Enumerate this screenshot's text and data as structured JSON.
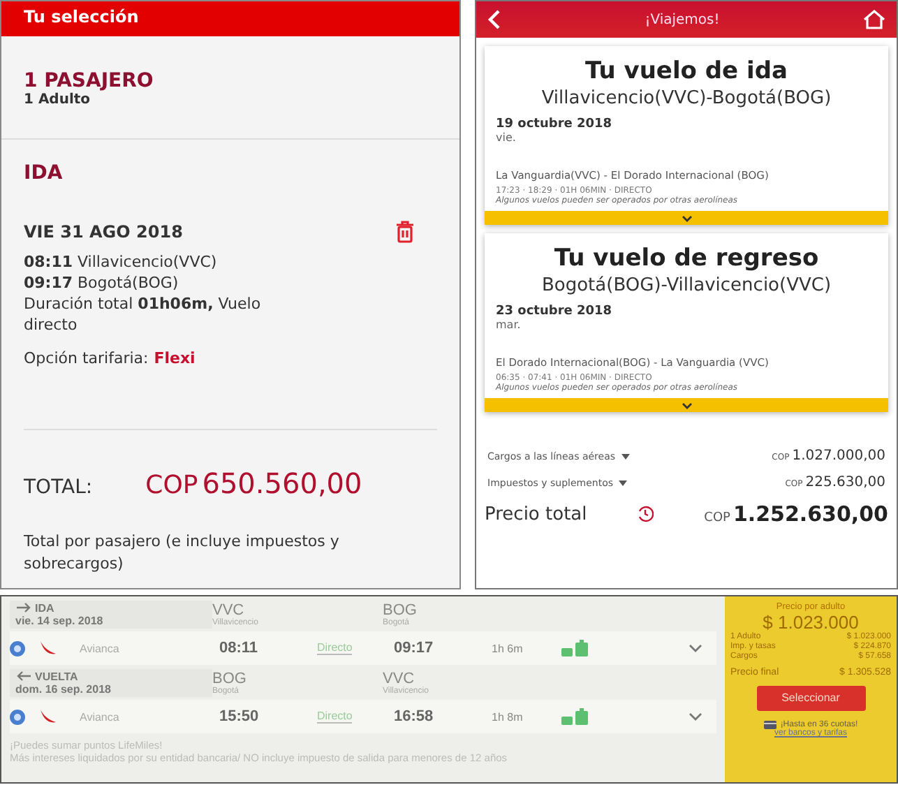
{
  "selection_panel": {
    "header": "Tu selección",
    "passengers_title": "1 PASAJERO",
    "passengers_detail": "1 Adulto",
    "direction": "IDA",
    "date": "VIE 31 AGO 2018",
    "departure": "**08:11** Villavicencio(VVC)",
    "arrival": "**09:17** Bogotá(BOG)",
    "duration": "Duración total **01h06m,** Vuelo directo",
    "fare_label": "Opción tarifaria:",
    "fare_value": "Flexi",
    "total_label": "TOTAL:",
    "total_currency": "COP",
    "total_amount": "650.560,00",
    "note": "Total por pasajero (e incluye impuestos y sobrecargos)"
  },
  "mobile_panel": {
    "title": "¡Viajemos!",
    "flights": [
      {
        "heading": "Tu vuelo de ida",
        "route": "Villavicencio(VVC)-Bogotá(BOG)",
        "date": "19 octubre 2018",
        "weekday": "vie.",
        "airports": "La Vanguardia(VVC) - El Dorado Internacional (BOG)",
        "details": "17:23 · 18:29 · 01H 06MIN · DIRECTO",
        "disclaimer": "Algunos vuelos pueden ser operados por otras aerolíneas"
      },
      {
        "heading": "Tu vuelo de regreso",
        "route": "Bogotá(BOG)-Villavicencio(VVC)",
        "date": "23 octubre 2018",
        "weekday": "mar.",
        "airports": "El Dorado Internacional(BOG) - La Vanguardia (VVC)",
        "details": "06:35 · 07:41 · 01H 06MIN · DIRECTO",
        "disclaimer": "Algunos vuelos pueden ser operados por otras aerolíneas"
      }
    ],
    "charges": [
      {
        "label": "Cargos a las líneas aéreas",
        "currency": "COP",
        "amount": "1.027.000,00"
      },
      {
        "label": "Impuestos y suplementos",
        "currency": "COP",
        "amount": "225.630,00"
      }
    ],
    "total_label": "Precio total",
    "total_currency": "COP",
    "total_amount": "1.252.630,00"
  },
  "results_panel": {
    "legs": [
      {
        "kind": "outbound",
        "direction": "IDA",
        "date": "vie. 14 sep. 2018",
        "origin_code": "VVC",
        "origin_city": "Villavicencio",
        "destination_code": "BOG",
        "destination_city": "Bogotá",
        "selected": true,
        "airline": "Avianca",
        "departure": "08:11",
        "stops": "Directo",
        "arrival": "09:17",
        "duration": "1h 6m"
      },
      {
        "kind": "return",
        "direction": "VUELTA",
        "date": "dom. 16 sep. 2018",
        "origin_code": "BOG",
        "origin_city": "Bogotá",
        "destination_code": "VVC",
        "destination_city": "Villavicencio",
        "selected": true,
        "airline": "Avianca",
        "departure": "15:50",
        "stops": "Directo",
        "arrival": "16:58",
        "duration": "1h 8m"
      }
    ],
    "notes": [
      "¡Puedes sumar puntos LifeMiles!",
      "Más intereses liquidados por su entidad bancaria/ NO incluye impuesto de salida para menores de 12 años"
    ],
    "price_box": {
      "title": "Precio por adulto",
      "price": "$ 1.023.000",
      "lines": [
        {
          "label": "1 Adulto",
          "value": "$ 1.023.000"
        },
        {
          "label": "Imp. y tasas",
          "value": "$ 224.870"
        },
        {
          "label": "Cargos",
          "value": "$ 57.658"
        }
      ],
      "final_label": "Precio final",
      "final_value": "$ 1.305.528",
      "button": "Seleccionar",
      "installments": "¡Hasta en 36 cuotas!",
      "installments_link": "ver bancos y tarifas"
    }
  }
}
